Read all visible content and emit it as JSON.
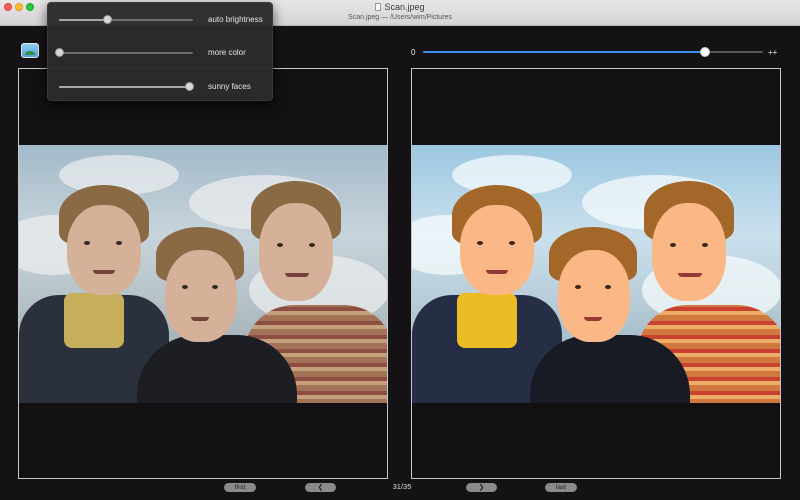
{
  "window": {
    "title": "Scan.jpeg",
    "path": "Scan.jpeg — /Users/wim/Pictures"
  },
  "adjustments": [
    {
      "label": "auto brightness",
      "value": 0.36
    },
    {
      "label": "more color",
      "value": 0.0
    },
    {
      "label": "sunny faces",
      "value": 0.97
    }
  ],
  "compare": {
    "min_label": "0",
    "max_label": "++",
    "value": 0.83,
    "accent": "#3d8ef0"
  },
  "navigation": {
    "first_label": "first",
    "prev_icon": "chevron-left-icon",
    "counter": "31/35",
    "next_icon": "chevron-right-icon",
    "last_label": "last"
  }
}
